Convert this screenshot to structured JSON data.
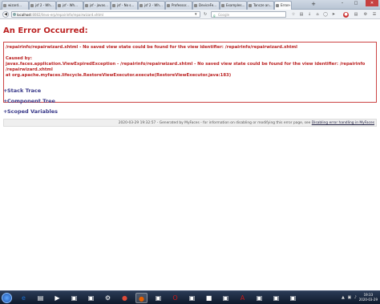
{
  "browser": {
    "tabs": [
      {
        "label": "wizard...",
        "favicon": "page-icon"
      },
      {
        "label": "jsf 2 - Wh...",
        "favicon": "stackoverflow-icon"
      },
      {
        "label": "jsf - Wh...",
        "favicon": "stackoverflow-icon"
      },
      {
        "label": "jsf - javas...",
        "favicon": "stackoverflow-icon"
      },
      {
        "label": "jsf - No s...",
        "favicon": "stackoverflow-icon"
      },
      {
        "label": "jsf 2 - Wh...",
        "favicon": "stackoverflow-icon"
      },
      {
        "label": "Professor...",
        "favicon": "google-icon"
      },
      {
        "label": "DeviceFe...",
        "favicon": "page-icon"
      },
      {
        "label": "Examples...",
        "favicon": "page-icon"
      },
      {
        "label": "Tancze an...",
        "favicon": "page-icon"
      },
      {
        "label": "Error -...",
        "favicon": "page-icon",
        "active": true
      }
    ],
    "new_tab": "+",
    "window_controls": {
      "minimize": "–",
      "maximize": "□",
      "close": "✕"
    },
    "url": {
      "host": "localhost",
      "path": ":8082/ilevo-erp/repairinfo/repairwizard.xhtml"
    },
    "search_placeholder": "Google",
    "search_engine_glyph": "g"
  },
  "page": {
    "title": "An Error Occurred:",
    "error_message": "/repairinfo/repairwizard.xhtml - No saved view state could be found for the view identifier: /repairinfo/repairwizard.xhtml",
    "cause_heading": "Caused by:",
    "cause_line1": "javax.faces.application.ViewExpiredException - /repairinfo/repairwizard.xhtml - No saved view state could be found for the view identifier: /repairinfo",
    "cause_line2": "/repairwizard.xhtml",
    "cause_line3": "at org.apache.myfaces.lifecycle.RestoreViewExecutor.execute(RestoreViewExecutor.java:183)",
    "sections": [
      "Stack Trace",
      "Component Tree",
      "Scoped Variables"
    ],
    "section_marker": "+",
    "footer_text": "2020-03-29 19:32:57 - Generated by MyFaces - for information on disabling or modifying this error page, see ",
    "footer_link": "Disabling error handling in MyFaces"
  },
  "taskbar": {
    "apps": [
      {
        "name": "ie-icon",
        "glyph": "e"
      },
      {
        "name": "folder-icon",
        "glyph": "▤"
      },
      {
        "name": "media-icon",
        "glyph": "▶"
      },
      {
        "name": "app-icon",
        "glyph": "▣"
      },
      {
        "name": "app-icon",
        "glyph": "▣"
      },
      {
        "name": "settings-icon",
        "glyph": "⚙"
      },
      {
        "name": "chrome-icon",
        "glyph": "●"
      },
      {
        "name": "firefox-icon",
        "glyph": "●",
        "active": true
      },
      {
        "name": "app-icon",
        "glyph": "▣"
      },
      {
        "name": "opera-icon",
        "glyph": "O"
      },
      {
        "name": "app-icon",
        "glyph": "▣"
      },
      {
        "name": "terminal-icon",
        "glyph": "■"
      },
      {
        "name": "app-icon",
        "glyph": "▣"
      },
      {
        "name": "pdf-icon",
        "glyph": "A"
      },
      {
        "name": "app-icon",
        "glyph": "▣"
      },
      {
        "name": "app-icon",
        "glyph": "▣"
      },
      {
        "name": "app-icon",
        "glyph": "▣"
      }
    ],
    "tray_icons": "▲ ▣ ♪",
    "time": "19:33",
    "date": "2020-03-29"
  },
  "colors": {
    "error_red": "#b22222",
    "section_link": "#3a3a8a",
    "firefox_orange": "#e66000",
    "chrome": "#dd4b39",
    "opera": "#cc1b1b",
    "pdf": "#c41a1a",
    "ie_blue": "#1b6fd1"
  }
}
